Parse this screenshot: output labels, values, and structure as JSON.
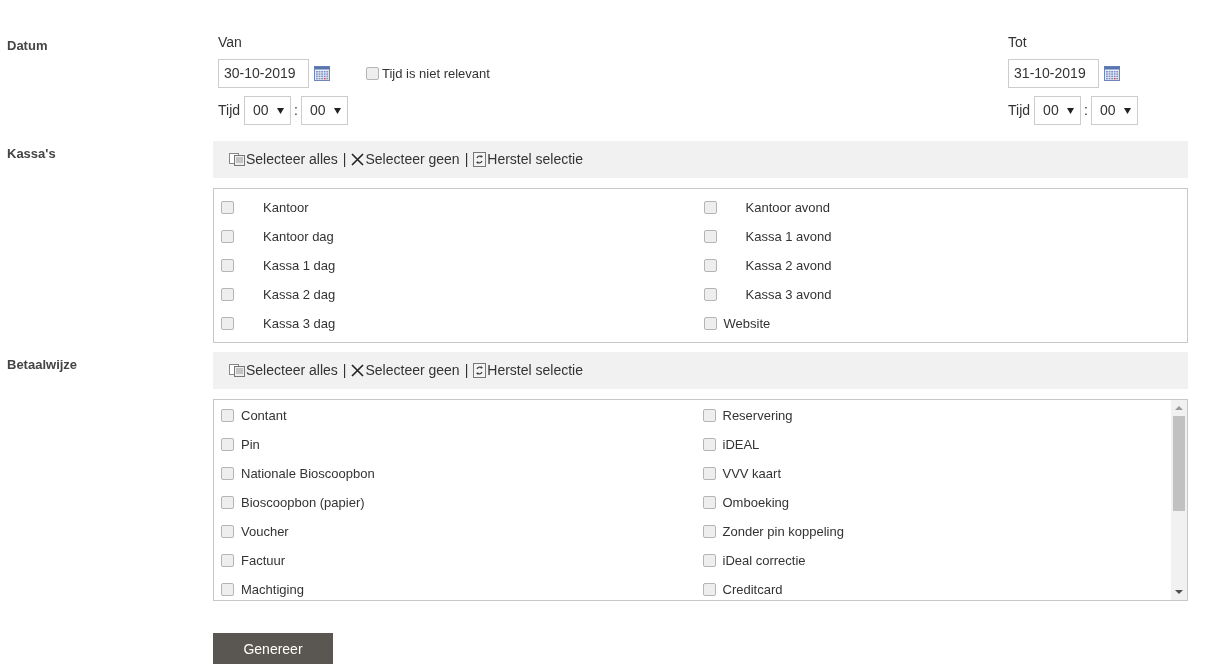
{
  "datum": {
    "label": "Datum",
    "van": {
      "label": "Van",
      "date": "30-10-2019",
      "time_label": "Tijd",
      "hour": "00",
      "separator": ":",
      "minute": "00"
    },
    "tijd_niet_relevant": {
      "label": "Tijd is niet relevant",
      "checked": false
    },
    "tot": {
      "label": "Tot",
      "date": "31-10-2019",
      "time_label": "Tijd",
      "hour": "00",
      "separator": ":",
      "minute": "00"
    }
  },
  "kassas": {
    "label": "Kassa's",
    "toolbar": [
      {
        "kind": "all",
        "label": "Selecteer alles"
      },
      {
        "kind": "none",
        "label": "Selecteer geen"
      },
      {
        "kind": "reset",
        "label": "Herstel selectie"
      }
    ],
    "toolbar_separator": "|",
    "items": [
      {
        "label": "Kantoor",
        "checked": false,
        "indented": true
      },
      {
        "label": "Kantoor avond",
        "checked": false,
        "indented": true
      },
      {
        "label": "Kantoor dag",
        "checked": false,
        "indented": true
      },
      {
        "label": "Kassa 1 avond",
        "checked": false,
        "indented": true
      },
      {
        "label": "Kassa 1 dag",
        "checked": false,
        "indented": true
      },
      {
        "label": "Kassa 2 avond",
        "checked": false,
        "indented": true
      },
      {
        "label": "Kassa 2 dag",
        "checked": false,
        "indented": true
      },
      {
        "label": "Kassa 3 avond",
        "checked": false,
        "indented": true
      },
      {
        "label": "Kassa 3 dag",
        "checked": false,
        "indented": true
      },
      {
        "label": "Website",
        "checked": false,
        "indented": false
      }
    ]
  },
  "betaalwijze": {
    "label": "Betaalwijze",
    "toolbar": [
      {
        "kind": "all",
        "label": "Selecteer alles"
      },
      {
        "kind": "none",
        "label": "Selecteer geen"
      },
      {
        "kind": "reset",
        "label": "Herstel selectie"
      }
    ],
    "toolbar_separator": "|",
    "items": [
      {
        "label": "Contant",
        "checked": false
      },
      {
        "label": "Reservering",
        "checked": false
      },
      {
        "label": "Pin",
        "checked": false
      },
      {
        "label": "iDEAL",
        "checked": false
      },
      {
        "label": "Nationale Bioscoopbon",
        "checked": false
      },
      {
        "label": "VVV kaart",
        "checked": false
      },
      {
        "label": "Bioscoopbon (papier)",
        "checked": false
      },
      {
        "label": "Omboeking",
        "checked": false
      },
      {
        "label": "Voucher",
        "checked": false
      },
      {
        "label": "Zonder pin koppeling",
        "checked": false
      },
      {
        "label": "Factuur",
        "checked": false
      },
      {
        "label": "iDeal correctie",
        "checked": false
      },
      {
        "label": "Machtiging",
        "checked": false
      },
      {
        "label": "Creditcard",
        "checked": false
      }
    ]
  },
  "submit": {
    "label": "Genereer"
  }
}
